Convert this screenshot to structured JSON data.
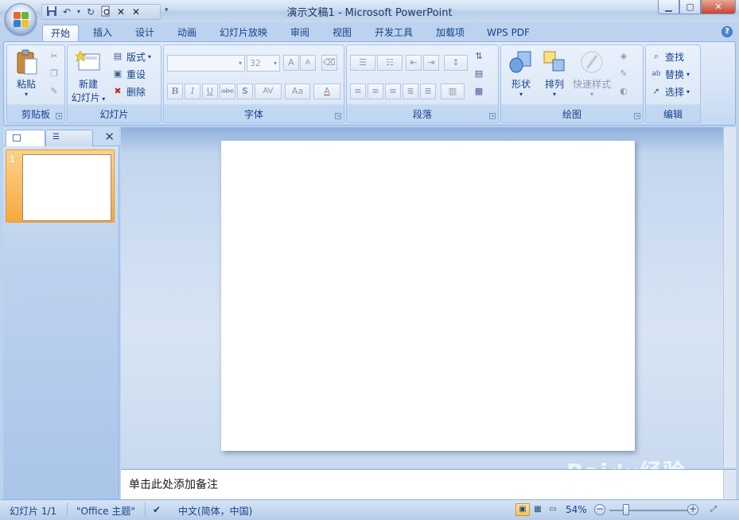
{
  "title_bar": {
    "title": "演示文稿1 - Microsoft PowerPoint",
    "qat_icons": [
      "save-icon",
      "undo-icon",
      "redo-icon",
      "print-preview-icon",
      "x-icon",
      "x-icon"
    ]
  },
  "tabs": [
    "开始",
    "插入",
    "设计",
    "动画",
    "幻灯片放映",
    "审阅",
    "视图",
    "开发工具",
    "加载项",
    "WPS PDF"
  ],
  "ribbon": {
    "clipboard": {
      "label": "剪贴板",
      "paste": "粘贴"
    },
    "slides": {
      "label": "幻灯片",
      "new_slide_line1": "新建",
      "new_slide_line2": "幻灯片",
      "layout": "版式",
      "reset": "重设",
      "delete": "删除"
    },
    "font": {
      "label": "字体",
      "font_size": "32",
      "bold": "B",
      "italic": "I",
      "underline": "U",
      "strike": "abc",
      "shadow": "S",
      "spacing": "AV",
      "case": "Aa",
      "color": "A",
      "grow": "A",
      "shrink": "A"
    },
    "paragraph": {
      "label": "段落"
    },
    "drawing": {
      "label": "绘图",
      "shapes": "形状",
      "arrange": "排列",
      "quick_styles": "快速样式"
    },
    "editing": {
      "label": "编辑",
      "find": "查找",
      "replace": "替换",
      "select": "选择"
    }
  },
  "thumbnail_panel": {
    "slide_number": "1"
  },
  "notes": {
    "placeholder": "单击此处添加备注"
  },
  "status_bar": {
    "slide_info": "幻灯片 1/1",
    "theme": "\"Office 主题\"",
    "language": "中文(简体，中国)",
    "zoom": "54%"
  },
  "watermark": "Baidu经验",
  "colors": {
    "ribbon_bg": "#dbe7f7",
    "accent": "#15428b",
    "thumbnail_highlight": "#f5a93e",
    "close_button": "#c8442f"
  }
}
